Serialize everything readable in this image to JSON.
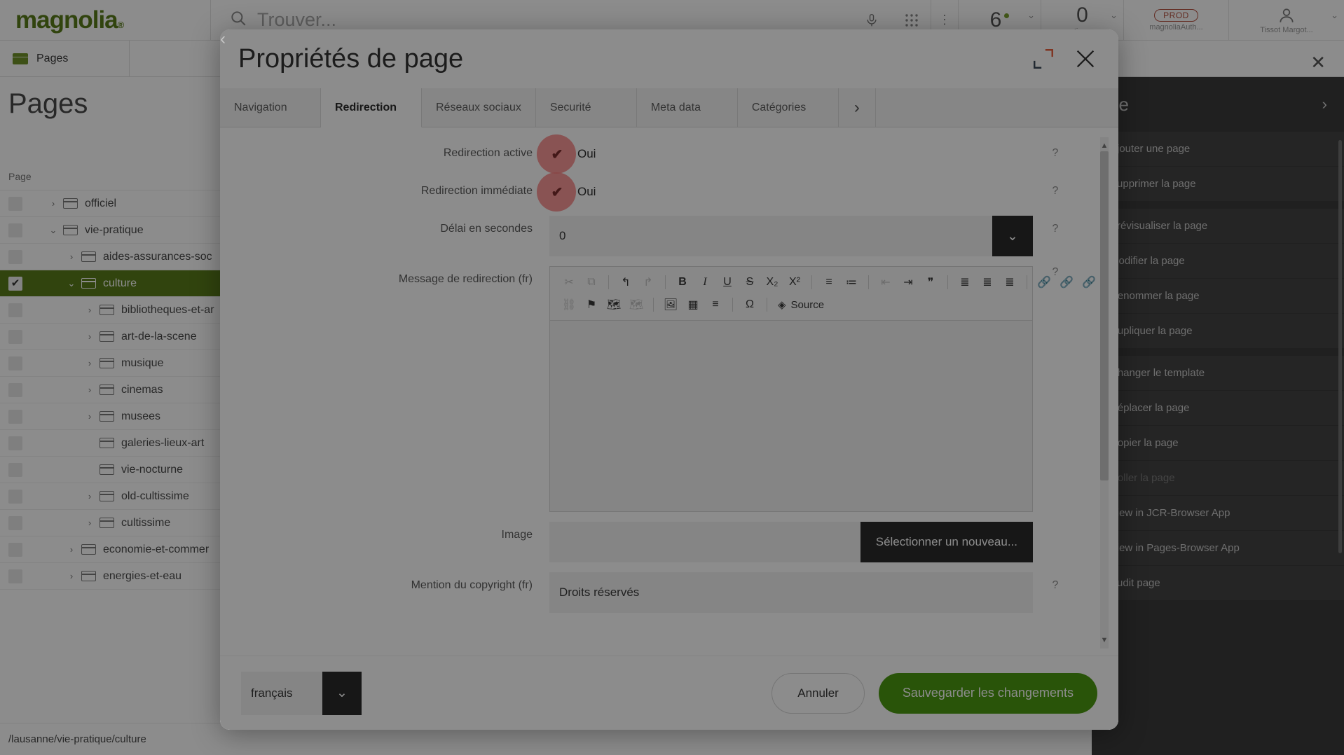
{
  "topbar": {
    "logo": "magnolia",
    "logo_mark": "®",
    "search_placeholder": "Trouver...",
    "mic_icon": "microphone-icon",
    "apps_icon": "apps-grid-icon",
    "kebab_icon": "kebab-menu-icon",
    "cells": [
      {
        "name": "pending-count",
        "value": "6",
        "sub": "",
        "dot": true,
        "chevron": "⌄"
      },
      {
        "name": "notifications-count",
        "value": "0",
        "sub": "tions",
        "dot": false,
        "chevron": "⌄"
      }
    ],
    "env_badge": "PROD",
    "env_sub": "magnoliaAuth...",
    "user_name": "Tissot Margot...",
    "user_icon": "user-avatar-icon",
    "user_chevron": "⌄"
  },
  "app_tab": {
    "label": "Pages",
    "icon": "pages-folder-icon",
    "close_icon": "close-icon"
  },
  "page": {
    "title": "Pages",
    "column_header": "Page",
    "status_path": "/lausanne/vie-pratique/culture"
  },
  "tree": {
    "rows": [
      {
        "label": "officiel",
        "indent": 1,
        "expander": "›",
        "selected": false,
        "checked": false
      },
      {
        "label": "vie-pratique",
        "indent": 1,
        "expander": "⌄",
        "selected": false,
        "checked": false
      },
      {
        "label": "aides-assurances-soc",
        "indent": 2,
        "expander": "›",
        "selected": false,
        "checked": false
      },
      {
        "label": "culture",
        "indent": 2,
        "expander": "⌄",
        "selected": true,
        "checked": true
      },
      {
        "label": "bibliotheques-et-ar",
        "indent": 3,
        "expander": "›",
        "selected": false,
        "checked": false
      },
      {
        "label": "art-de-la-scene",
        "indent": 3,
        "expander": "›",
        "selected": false,
        "checked": false
      },
      {
        "label": "musique",
        "indent": 3,
        "expander": "›",
        "selected": false,
        "checked": false
      },
      {
        "label": "cinemas",
        "indent": 3,
        "expander": "›",
        "selected": false,
        "checked": false
      },
      {
        "label": "musees",
        "indent": 3,
        "expander": "›",
        "selected": false,
        "checked": false
      },
      {
        "label": "galeries-lieux-art",
        "indent": 3,
        "expander": "",
        "selected": false,
        "checked": false
      },
      {
        "label": "vie-nocturne",
        "indent": 3,
        "expander": "",
        "selected": false,
        "checked": false
      },
      {
        "label": "old-cultissime",
        "indent": 3,
        "expander": "›",
        "selected": false,
        "checked": false
      },
      {
        "label": "cultissime",
        "indent": 3,
        "expander": "›",
        "selected": false,
        "checked": false
      },
      {
        "label": "economie-et-commer",
        "indent": 2,
        "expander": "›",
        "selected": false,
        "checked": false
      },
      {
        "label": "energies-et-eau",
        "indent": 2,
        "expander": "›",
        "selected": false,
        "checked": false
      }
    ]
  },
  "action_panel": {
    "title": "ge",
    "expand_icon": "chevron-right-icon",
    "groups": [
      [
        "Ajouter une page",
        "Supprimer la page"
      ],
      [
        "Prévisualiser la page",
        "Modifier la page",
        "Renommer la page",
        "Dupliquer la page"
      ],
      [
        "Changer le template",
        "Déplacer la page",
        "Copier la page",
        "Coller la page",
        "View in JCR-Browser App",
        "View in Pages-Browser App",
        "Audit page"
      ]
    ],
    "disabled_items": [
      "Coller la page"
    ]
  },
  "dialog": {
    "title": "Propriétés de page",
    "expand_icon": "expand-icon",
    "close_icon": "close-icon",
    "tabs": [
      {
        "label": "Navigation",
        "active": false
      },
      {
        "label": "Redirection",
        "active": true
      },
      {
        "label": "Réseaux sociaux",
        "active": false
      },
      {
        "label": "Securité",
        "active": false
      },
      {
        "label": "Meta data",
        "active": false
      },
      {
        "label": "Catégories",
        "active": false
      }
    ],
    "tab_prev_icon": "chevron-left-icon",
    "tab_next_icon": "chevron-right-icon",
    "fields": {
      "redirect_active": {
        "label": "Redirection active",
        "value": "Oui",
        "checked": true,
        "help": "?"
      },
      "redirect_immediate": {
        "label": "Redirection immédiate",
        "value": "Oui",
        "checked": true,
        "help": "?"
      },
      "delay": {
        "label": "Délai en secondes",
        "value": "0",
        "help": "?",
        "dropdown_icon": "chevron-down-icon"
      },
      "message": {
        "label": "Message de redirection (fr)",
        "value": "",
        "help": "?"
      },
      "image": {
        "label": "Image",
        "value": "",
        "button": "Sélectionner un nouveau..."
      },
      "copyright": {
        "label": "Mention du copyright (fr)",
        "value": "Droits réservés",
        "help": "?"
      }
    },
    "editor_toolbar": {
      "row1": [
        {
          "icon": "cut-icon",
          "glyph": "✂",
          "faded": true
        },
        {
          "icon": "copy-icon",
          "glyph": "⧉",
          "faded": true
        },
        {
          "icon": "separator",
          "glyph": "",
          "faded": false
        },
        {
          "icon": "undo-icon",
          "glyph": "↰",
          "faded": false
        },
        {
          "icon": "redo-icon",
          "glyph": "↱",
          "faded": true
        },
        {
          "icon": "separator",
          "glyph": "",
          "faded": false
        },
        {
          "icon": "bold-icon",
          "glyph": "B",
          "faded": false
        },
        {
          "icon": "italic-icon",
          "glyph": "I",
          "faded": false
        },
        {
          "icon": "underline-icon",
          "glyph": "U",
          "faded": false
        },
        {
          "icon": "strikethrough-icon",
          "glyph": "S",
          "faded": false
        },
        {
          "icon": "subscript-icon",
          "glyph": "X₂",
          "faded": false
        },
        {
          "icon": "superscript-icon",
          "glyph": "X²",
          "faded": false
        },
        {
          "icon": "separator",
          "glyph": "",
          "faded": false
        },
        {
          "icon": "numbered-list-icon",
          "glyph": "≡",
          "faded": false
        },
        {
          "icon": "bulleted-list-icon",
          "glyph": "≔",
          "faded": false
        },
        {
          "icon": "separator",
          "glyph": "",
          "faded": false
        },
        {
          "icon": "decrease-indent-icon",
          "glyph": "⇤",
          "faded": true
        },
        {
          "icon": "increase-indent-icon",
          "glyph": "⇥",
          "faded": false
        },
        {
          "icon": "blockquote-icon",
          "glyph": "❞",
          "faded": false
        },
        {
          "icon": "separator",
          "glyph": "",
          "faded": false
        },
        {
          "icon": "align-left-icon",
          "glyph": "≣",
          "faded": false
        },
        {
          "icon": "align-center-icon",
          "glyph": "≣",
          "faded": false
        },
        {
          "icon": "align-right-icon",
          "glyph": "≣",
          "faded": false
        },
        {
          "icon": "separator",
          "glyph": "",
          "faded": false
        },
        {
          "icon": "link-icon",
          "glyph": "🔗",
          "faded": false
        },
        {
          "icon": "internal-link-icon",
          "glyph": "🔗",
          "faded": false
        },
        {
          "icon": "anchor-link-icon",
          "glyph": "🔗",
          "faded": false
        }
      ],
      "row2": [
        {
          "icon": "unlink-icon",
          "glyph": "⛓",
          "faded": true
        },
        {
          "icon": "anchor-flag-icon",
          "glyph": "⚑",
          "faded": false
        },
        {
          "icon": "map-add-icon",
          "glyph": "🗺",
          "faded": false
        },
        {
          "icon": "map-remove-icon",
          "glyph": "🗺",
          "faded": true
        },
        {
          "icon": "separator",
          "glyph": "",
          "faded": false
        },
        {
          "icon": "image-icon",
          "glyph": "🖼",
          "faded": false
        },
        {
          "icon": "table-icon",
          "glyph": "▦",
          "faded": false
        },
        {
          "icon": "horizontal-rule-icon",
          "glyph": "≡",
          "faded": false
        },
        {
          "icon": "separator",
          "glyph": "",
          "faded": false
        },
        {
          "icon": "special-character-icon",
          "glyph": "Ω",
          "faded": false
        },
        {
          "icon": "separator",
          "glyph": "",
          "faded": false
        },
        {
          "icon": "source-icon",
          "glyph": "◈",
          "faded": false,
          "label": "Source"
        }
      ]
    },
    "footer": {
      "language": "français",
      "language_arrow": "chevron-down-icon",
      "cancel": "Annuler",
      "save": "Sauvegarder les changements"
    }
  },
  "colors": {
    "brand_green": "#5a7d1b",
    "save_green": "#4c9a12",
    "highlight_red": "#f98080",
    "dark_panel": "#3b3b3b",
    "prod_badge": "#b4503f"
  }
}
